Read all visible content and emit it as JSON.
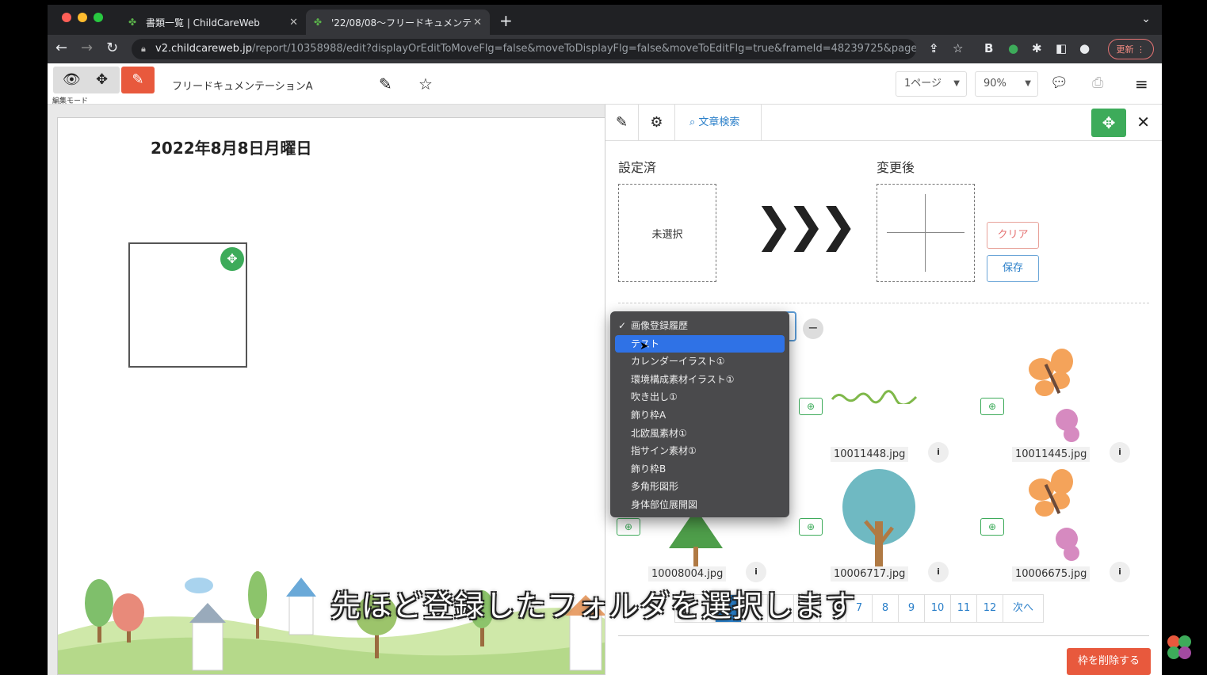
{
  "browser": {
    "tabs": [
      {
        "title": "書類一覧 | ChildCareWeb"
      },
      {
        "title": "'22/08/08〜フリードキュメンテ"
      }
    ],
    "url_host": "v2.childcareweb.jp",
    "url_path": "/report/10358988/edit?displayOrEditToMoveFlg=false&moveToDisplayFlg=false&moveToEditFlg=true&frameId=48239725&page...",
    "update_label": "更新"
  },
  "toolbar": {
    "mode_label": "編集モード",
    "doc_title": "フリードキュメンテーションA",
    "page_select": "1ページ",
    "zoom_select": "90%"
  },
  "canvas": {
    "date": "2022年8月8日月曜日"
  },
  "panel": {
    "search_label": "文章検索",
    "configured_label": "設定済",
    "after_label": "変更後",
    "unselected_text": "未選択",
    "clear_label": "クリア",
    "save_label": "保存",
    "images": [
      {
        "file": "10011448.jpg"
      },
      {
        "file": "10011445.jpg"
      },
      {
        "file": "10008004.jpg"
      },
      {
        "file": "10006717.jpg"
      },
      {
        "file": "10006675.jpg"
      }
    ],
    "pager": [
      "7",
      "8",
      "9",
      "10",
      "11",
      "12",
      "次へ"
    ],
    "delete_label": "枠を削除する"
  },
  "dropdown": {
    "options": [
      "画像登録履歴",
      "テスト",
      "カレンダーイラスト①",
      "環境構成素材イラスト①",
      "吹き出し①",
      "飾り枠A",
      "北欧風素材①",
      "指サイン素材①",
      "飾り枠B",
      "多角形図形",
      "身体部位展開図"
    ],
    "checked_index": 0,
    "highlighted_index": 1
  },
  "subtitle": "先ほど登録したフォルダを選択します",
  "colors": {
    "accent_green": "#3dab5a",
    "accent_red": "#e8593d",
    "highlight_blue": "#2f72e6"
  }
}
